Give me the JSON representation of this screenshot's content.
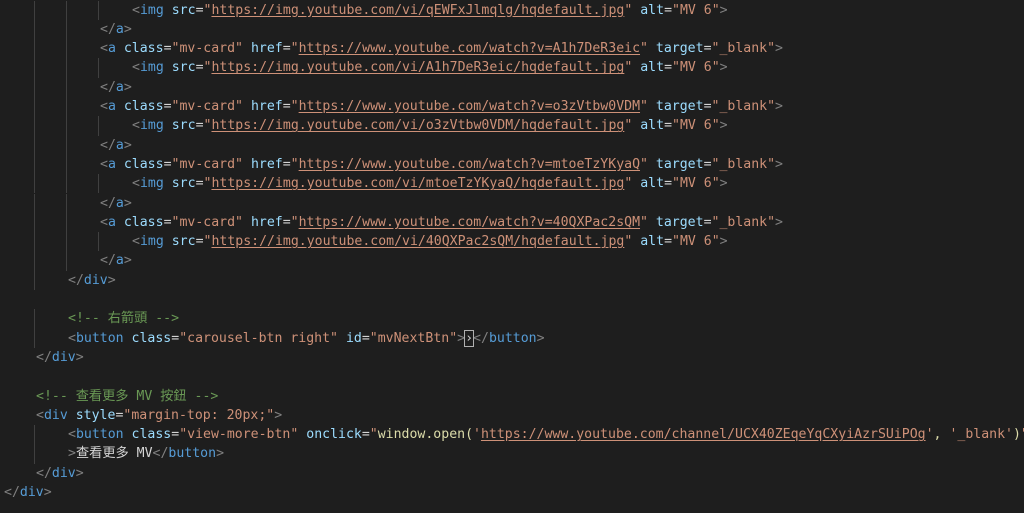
{
  "lines": [
    {
      "indent": 128,
      "tokens": [
        [
          "tag",
          "<"
        ],
        [
          "name",
          "img"
        ],
        [
          "text",
          " "
        ],
        [
          "attr",
          "src"
        ],
        [
          "text",
          "="
        ],
        [
          "str",
          "\""
        ],
        [
          "url",
          "https://img.youtube.com/vi/qEWFxJlmqlg/hqdefault.jpg"
        ],
        [
          "str",
          "\""
        ],
        [
          "text",
          " "
        ],
        [
          "attr",
          "alt"
        ],
        [
          "text",
          "="
        ],
        [
          "str",
          "\"MV 6\""
        ],
        [
          "tag",
          ">"
        ]
      ]
    },
    {
      "indent": 96,
      "tokens": [
        [
          "tag",
          "</"
        ],
        [
          "name",
          "a"
        ],
        [
          "tag",
          ">"
        ]
      ]
    },
    {
      "indent": 96,
      "tokens": [
        [
          "tag",
          "<"
        ],
        [
          "name",
          "a"
        ],
        [
          "text",
          " "
        ],
        [
          "attr",
          "class"
        ],
        [
          "text",
          "="
        ],
        [
          "str",
          "\"mv-card\""
        ],
        [
          "text",
          " "
        ],
        [
          "attr",
          "href"
        ],
        [
          "text",
          "="
        ],
        [
          "str",
          "\""
        ],
        [
          "url",
          "https://www.youtube.com/watch?v=A1h7DeR3eic"
        ],
        [
          "str",
          "\""
        ],
        [
          "text",
          " "
        ],
        [
          "attr",
          "target"
        ],
        [
          "text",
          "="
        ],
        [
          "str",
          "\"_blank\""
        ],
        [
          "tag",
          ">"
        ]
      ]
    },
    {
      "indent": 128,
      "tokens": [
        [
          "tag",
          "<"
        ],
        [
          "name",
          "img"
        ],
        [
          "text",
          " "
        ],
        [
          "attr",
          "src"
        ],
        [
          "text",
          "="
        ],
        [
          "str",
          "\""
        ],
        [
          "url",
          "https://img.youtube.com/vi/A1h7DeR3eic/hqdefault.jpg"
        ],
        [
          "str",
          "\""
        ],
        [
          "text",
          " "
        ],
        [
          "attr",
          "alt"
        ],
        [
          "text",
          "="
        ],
        [
          "str",
          "\"MV 6\""
        ],
        [
          "tag",
          ">"
        ]
      ]
    },
    {
      "indent": 96,
      "tokens": [
        [
          "tag",
          "</"
        ],
        [
          "name",
          "a"
        ],
        [
          "tag",
          ">"
        ]
      ]
    },
    {
      "indent": 96,
      "tokens": [
        [
          "tag",
          "<"
        ],
        [
          "name",
          "a"
        ],
        [
          "text",
          " "
        ],
        [
          "attr",
          "class"
        ],
        [
          "text",
          "="
        ],
        [
          "str",
          "\"mv-card\""
        ],
        [
          "text",
          " "
        ],
        [
          "attr",
          "href"
        ],
        [
          "text",
          "="
        ],
        [
          "str",
          "\""
        ],
        [
          "url",
          "https://www.youtube.com/watch?v=o3zVtbw0VDM"
        ],
        [
          "str",
          "\""
        ],
        [
          "text",
          " "
        ],
        [
          "attr",
          "target"
        ],
        [
          "text",
          "="
        ],
        [
          "str",
          "\"_blank\""
        ],
        [
          "tag",
          ">"
        ]
      ]
    },
    {
      "indent": 128,
      "tokens": [
        [
          "tag",
          "<"
        ],
        [
          "name",
          "img"
        ],
        [
          "text",
          " "
        ],
        [
          "attr",
          "src"
        ],
        [
          "text",
          "="
        ],
        [
          "str",
          "\""
        ],
        [
          "url",
          "https://img.youtube.com/vi/o3zVtbw0VDM/hqdefault.jpg"
        ],
        [
          "str",
          "\""
        ],
        [
          "text",
          " "
        ],
        [
          "attr",
          "alt"
        ],
        [
          "text",
          "="
        ],
        [
          "str",
          "\"MV 6\""
        ],
        [
          "tag",
          ">"
        ]
      ]
    },
    {
      "indent": 96,
      "tokens": [
        [
          "tag",
          "</"
        ],
        [
          "name",
          "a"
        ],
        [
          "tag",
          ">"
        ]
      ]
    },
    {
      "indent": 96,
      "tokens": [
        [
          "tag",
          "<"
        ],
        [
          "name",
          "a"
        ],
        [
          "text",
          " "
        ],
        [
          "attr",
          "class"
        ],
        [
          "text",
          "="
        ],
        [
          "str",
          "\"mv-card\""
        ],
        [
          "text",
          " "
        ],
        [
          "attr",
          "href"
        ],
        [
          "text",
          "="
        ],
        [
          "str",
          "\""
        ],
        [
          "url",
          "https://www.youtube.com/watch?v=mtoeTzYKyaQ"
        ],
        [
          "str",
          "\""
        ],
        [
          "text",
          " "
        ],
        [
          "attr",
          "target"
        ],
        [
          "text",
          "="
        ],
        [
          "str",
          "\"_blank\""
        ],
        [
          "tag",
          ">"
        ]
      ]
    },
    {
      "indent": 128,
      "tokens": [
        [
          "tag",
          "<"
        ],
        [
          "name",
          "img"
        ],
        [
          "text",
          " "
        ],
        [
          "attr",
          "src"
        ],
        [
          "text",
          "="
        ],
        [
          "str",
          "\""
        ],
        [
          "url",
          "https://img.youtube.com/vi/mtoeTzYKyaQ/hqdefault.jpg"
        ],
        [
          "str",
          "\""
        ],
        [
          "text",
          " "
        ],
        [
          "attr",
          "alt"
        ],
        [
          "text",
          "="
        ],
        [
          "str",
          "\"MV 6\""
        ],
        [
          "tag",
          ">"
        ]
      ]
    },
    {
      "indent": 96,
      "tokens": [
        [
          "tag",
          "</"
        ],
        [
          "name",
          "a"
        ],
        [
          "tag",
          ">"
        ]
      ]
    },
    {
      "indent": 96,
      "tokens": [
        [
          "tag",
          "<"
        ],
        [
          "name",
          "a"
        ],
        [
          "text",
          " "
        ],
        [
          "attr",
          "class"
        ],
        [
          "text",
          "="
        ],
        [
          "str",
          "\"mv-card\""
        ],
        [
          "text",
          " "
        ],
        [
          "attr",
          "href"
        ],
        [
          "text",
          "="
        ],
        [
          "str",
          "\""
        ],
        [
          "url",
          "https://www.youtube.com/watch?v=40QXPac2sQM"
        ],
        [
          "str",
          "\""
        ],
        [
          "text",
          " "
        ],
        [
          "attr",
          "target"
        ],
        [
          "text",
          "="
        ],
        [
          "str",
          "\"_blank\""
        ],
        [
          "tag",
          ">"
        ]
      ]
    },
    {
      "indent": 128,
      "tokens": [
        [
          "tag",
          "<"
        ],
        [
          "name",
          "img"
        ],
        [
          "text",
          " "
        ],
        [
          "attr",
          "src"
        ],
        [
          "text",
          "="
        ],
        [
          "str",
          "\""
        ],
        [
          "url",
          "https://img.youtube.com/vi/40QXPac2sQM/hqdefault.jpg"
        ],
        [
          "str",
          "\""
        ],
        [
          "text",
          " "
        ],
        [
          "attr",
          "alt"
        ],
        [
          "text",
          "="
        ],
        [
          "str",
          "\"MV 6\""
        ],
        [
          "tag",
          ">"
        ]
      ]
    },
    {
      "indent": 96,
      "tokens": [
        [
          "tag",
          "</"
        ],
        [
          "name",
          "a"
        ],
        [
          "tag",
          ">"
        ]
      ]
    },
    {
      "indent": 64,
      "tokens": [
        [
          "tag",
          "</"
        ],
        [
          "name",
          "div"
        ],
        [
          "tag",
          ">"
        ]
      ]
    },
    {
      "indent": 0,
      "tokens": []
    },
    {
      "indent": 64,
      "tokens": [
        [
          "comment",
          "<!-- 右箭頭 -->"
        ]
      ]
    },
    {
      "indent": 64,
      "tokens": [
        [
          "tag",
          "<"
        ],
        [
          "name",
          "button"
        ],
        [
          "text",
          " "
        ],
        [
          "attr",
          "class"
        ],
        [
          "text",
          "="
        ],
        [
          "str",
          "\"carousel-btn right\""
        ],
        [
          "text",
          " "
        ],
        [
          "attr",
          "id"
        ],
        [
          "text",
          "="
        ],
        [
          "str",
          "\"mvNextBtn\""
        ],
        [
          "tag",
          ">"
        ],
        [
          "bracket",
          "›"
        ],
        [
          "tag",
          "</"
        ],
        [
          "name",
          "button"
        ],
        [
          "tag",
          ">"
        ]
      ]
    },
    {
      "indent": 32,
      "tokens": [
        [
          "tag",
          "</"
        ],
        [
          "name",
          "div"
        ],
        [
          "tag",
          ">"
        ]
      ]
    },
    {
      "indent": 0,
      "tokens": []
    },
    {
      "indent": 32,
      "tokens": [
        [
          "comment",
          "<!-- 查看更多 MV 按鈕 -->"
        ]
      ]
    },
    {
      "indent": 32,
      "tokens": [
        [
          "tag",
          "<"
        ],
        [
          "name",
          "div"
        ],
        [
          "text",
          " "
        ],
        [
          "attr",
          "style"
        ],
        [
          "text",
          "="
        ],
        [
          "str",
          "\"margin-top: 20px;\""
        ],
        [
          "tag",
          ">"
        ]
      ]
    },
    {
      "indent": 64,
      "tokens": [
        [
          "tag",
          "<"
        ],
        [
          "name",
          "button"
        ],
        [
          "text",
          " "
        ],
        [
          "attr",
          "class"
        ],
        [
          "text",
          "="
        ],
        [
          "str",
          "\"view-more-btn\""
        ],
        [
          "text",
          " "
        ],
        [
          "attr",
          "onclick"
        ],
        [
          "text",
          "="
        ],
        [
          "str",
          "\""
        ],
        [
          "js",
          "window.open("
        ],
        [
          "jsstr",
          "'"
        ],
        [
          "url",
          "https://www.youtube.com/channel/UCX40ZEqeYqCXyiAzrSUiPOg"
        ],
        [
          "jsstr",
          "'"
        ],
        [
          "js",
          ", "
        ],
        [
          "jsstr",
          "'_blank'"
        ],
        [
          "js",
          ")"
        ],
        [
          "str",
          "\""
        ]
      ]
    },
    {
      "indent": 64,
      "tokens": [
        [
          "tag",
          ">"
        ],
        [
          "text",
          "查看更多 MV"
        ],
        [
          "tag",
          "</"
        ],
        [
          "name",
          "button"
        ],
        [
          "tag",
          ">"
        ]
      ]
    },
    {
      "indent": 32,
      "tokens": [
        [
          "tag",
          "</"
        ],
        [
          "name",
          "div"
        ],
        [
          "tag",
          ">"
        ]
      ]
    },
    {
      "indent": 0,
      "tokens": [
        [
          "tag",
          "</"
        ],
        [
          "name",
          "div"
        ],
        [
          "tag",
          ">"
        ]
      ]
    }
  ]
}
